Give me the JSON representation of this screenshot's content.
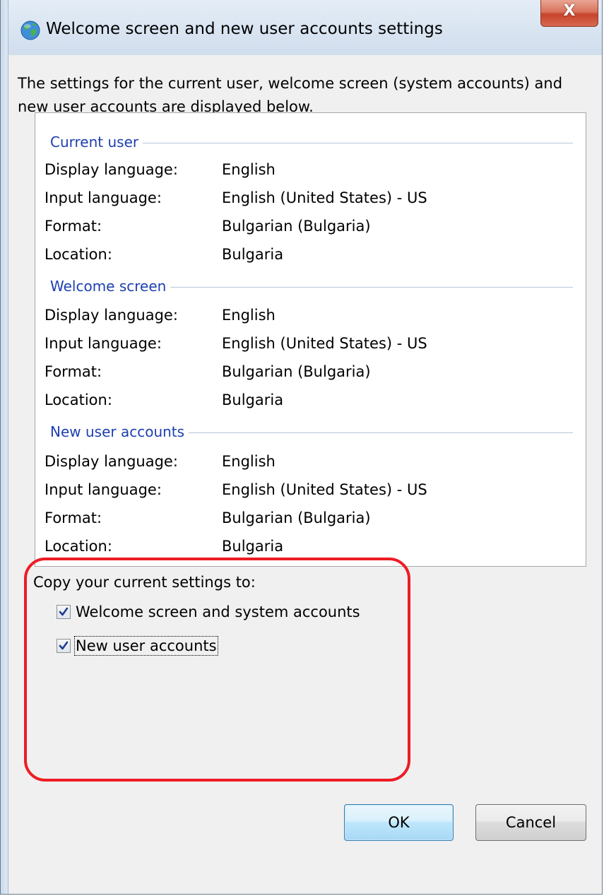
{
  "window": {
    "title": "Welcome screen and new user accounts settings",
    "close_label": "X"
  },
  "description": "The settings for the current user, welcome screen (system accounts) and new user accounts are displayed below.",
  "groups": [
    {
      "header": "Current user",
      "rows": [
        {
          "label": "Display language:",
          "value": "English"
        },
        {
          "label": "Input language:",
          "value": "English (United States) - US"
        },
        {
          "label": "Format:",
          "value": "Bulgarian (Bulgaria)"
        },
        {
          "label": "Location:",
          "value": "Bulgaria"
        }
      ]
    },
    {
      "header": "Welcome screen",
      "rows": [
        {
          "label": "Display language:",
          "value": "English"
        },
        {
          "label": "Input language:",
          "value": "English (United States) - US"
        },
        {
          "label": "Format:",
          "value": "Bulgarian (Bulgaria)"
        },
        {
          "label": "Location:",
          "value": "Bulgaria"
        }
      ]
    },
    {
      "header": "New user accounts",
      "rows": [
        {
          "label": "Display language:",
          "value": "English"
        },
        {
          "label": "Input language:",
          "value": "English (United States) - US"
        },
        {
          "label": "Format:",
          "value": "Bulgarian (Bulgaria)"
        },
        {
          "label": "Location:",
          "value": "Bulgaria"
        }
      ]
    }
  ],
  "copy_section": {
    "title": "Copy your current settings to:",
    "options": [
      {
        "label": "Welcome screen and system accounts",
        "checked": true
      },
      {
        "label": "New user accounts",
        "checked": true
      }
    ]
  },
  "buttons": {
    "ok": "OK",
    "cancel": "Cancel"
  },
  "colors": {
    "group_header": "#1e40af",
    "highlight": "#ed1c24",
    "checkmark": "#1f3d8c"
  },
  "icons": {
    "title": "globe-icon",
    "close": "close-icon",
    "check": "checkmark-icon"
  }
}
